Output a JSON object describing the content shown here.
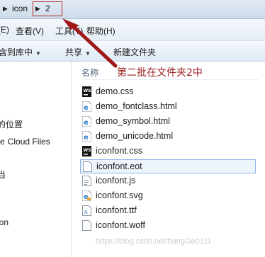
{
  "breadcrumb": {
    "items": [
      "icon",
      "2"
    ]
  },
  "menu": {
    "items": [
      "查看(V)",
      "工具(T)",
      "帮助(H)"
    ],
    "partial_left": "(E)"
  },
  "toolbar": {
    "include_library": "含到库中",
    "share": "共享",
    "new_folder": "新建文件夹"
  },
  "nav": {
    "items": [
      "的位置",
      "Cloud Files",
      "当",
      "ion"
    ]
  },
  "column": {
    "name_header": "名称"
  },
  "files": [
    {
      "name": "demo.css",
      "icon": "webstorm-css-icon"
    },
    {
      "name": "demo_fontclass.html",
      "icon": "ie-html-icon"
    },
    {
      "name": "demo_symbol.html",
      "icon": "ie-html-icon"
    },
    {
      "name": "demo_unicode.html",
      "icon": "ie-html-icon"
    },
    {
      "name": "iconfont.css",
      "icon": "webstorm-css-icon"
    },
    {
      "name": "iconfont.eot",
      "icon": "blank-file-icon",
      "selected": true
    },
    {
      "name": "iconfont.js",
      "icon": "js-file-icon"
    },
    {
      "name": "iconfont.svg",
      "icon": "ie-svg-icon"
    },
    {
      "name": "iconfont.ttf",
      "icon": "font-file-icon"
    },
    {
      "name": "iconfont.woff",
      "icon": "blank-file-icon"
    }
  ],
  "annotation": "第二批在文件夹2中",
  "watermark": "https://blog.csdn.net/hangGe0111",
  "colors": {
    "annotation": "#9b1c1c",
    "highlight_box": "#b3261e",
    "ie_icon": "#2f7fd0",
    "ws_icon": "#111111"
  }
}
